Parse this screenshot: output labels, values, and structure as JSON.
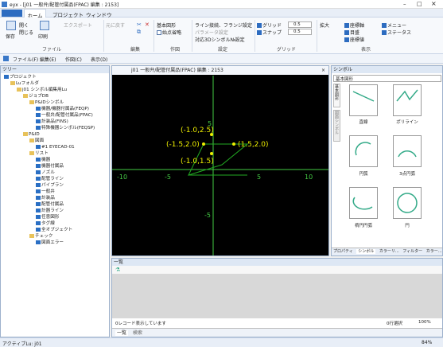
{
  "window": {
    "title": "eyx - [j01 一般弁/配管付属品(FPAC) 編集 : 2153]"
  },
  "tabs": [
    "ホーム",
    "プロジェクト",
    "ウィンドウ"
  ],
  "ribbon": {
    "save": "保存",
    "open": "開く",
    "close": "閉じる",
    "print": "印刷",
    "export": "エクスポート",
    "undo": "元に戻す",
    "basic_shape": "基本図形",
    "start_end": "始点省略",
    "line_flange": "ライン接続、フランジ設定",
    "param_set": "パラメータ設定",
    "symbol_no": "対応3Dシンボル№設定",
    "grid": "グリッド",
    "snap": "スナップ",
    "grid_val1": "0.5",
    "grid_val2": "0.5",
    "zoom": "拡大",
    "coords": "座標軸",
    "outline": "目盛",
    "coord_val": "座標値",
    "menu": "メニュー",
    "status": "ステータス",
    "groups": [
      "ファイル",
      "編集",
      "作図",
      "設定",
      "グリッド",
      "表示"
    ]
  },
  "menubar": [
    "ファイル(F)",
    "編集(E)",
    "作図(C)",
    "表示(D)"
  ],
  "tree": {
    "header": "ツリー",
    "items": [
      "プロジェクト",
      "Luフォルダ",
      "j01 シンボル編集用Lu",
      "ジョブDB",
      "P&IDシンボル",
      "機器/機器付属品(FEQP)",
      "一般弁/配管付属品(FPAC)",
      "計装品(FINS)",
      "特殊機器シンボル(FEQSP)",
      "P&ID",
      "図面",
      "#1 EYECAD-01",
      "リスト",
      "機器",
      "機器付属品",
      "ノズル",
      "配管ライン",
      "パイプラン",
      "一般弁",
      "計装品",
      "配管付属品",
      "計器ライン",
      "任意図形",
      "タグ線",
      "全オブジェクト",
      "チェック",
      "図面エラー"
    ]
  },
  "canvas": {
    "title": "j01 一般弁/配管付属品(FPAC) 編集 : 2153",
    "labels": [
      "(-1.0,2.5)",
      "(-1.5,2.0)",
      "(1.5,2.0)",
      "(-1.0,1.5)"
    ],
    "axis": [
      "-10",
      "-5",
      "5",
      "10",
      "5",
      "-5"
    ]
  },
  "symbols": {
    "header": "シンボル",
    "category": "基本図形",
    "side_tabs": [
      "基本図形",
      "図面シンボル"
    ],
    "items": [
      "直線",
      "ポリライン",
      "円弧",
      "3点円弧",
      "楕円円弧",
      "円"
    ],
    "bottom_tabs": [
      "プロパティ",
      "シンボル",
      "カラーリ...",
      "フィルター",
      "カラー..."
    ]
  },
  "list": {
    "header": "一覧",
    "status": "0レコード表示しています",
    "sel": "0行選択",
    "zoom": "100%",
    "tabs": [
      "一覧",
      "検索"
    ]
  },
  "statusbar": {
    "left": "アクティブLu: j01",
    "zoom": "84%"
  }
}
